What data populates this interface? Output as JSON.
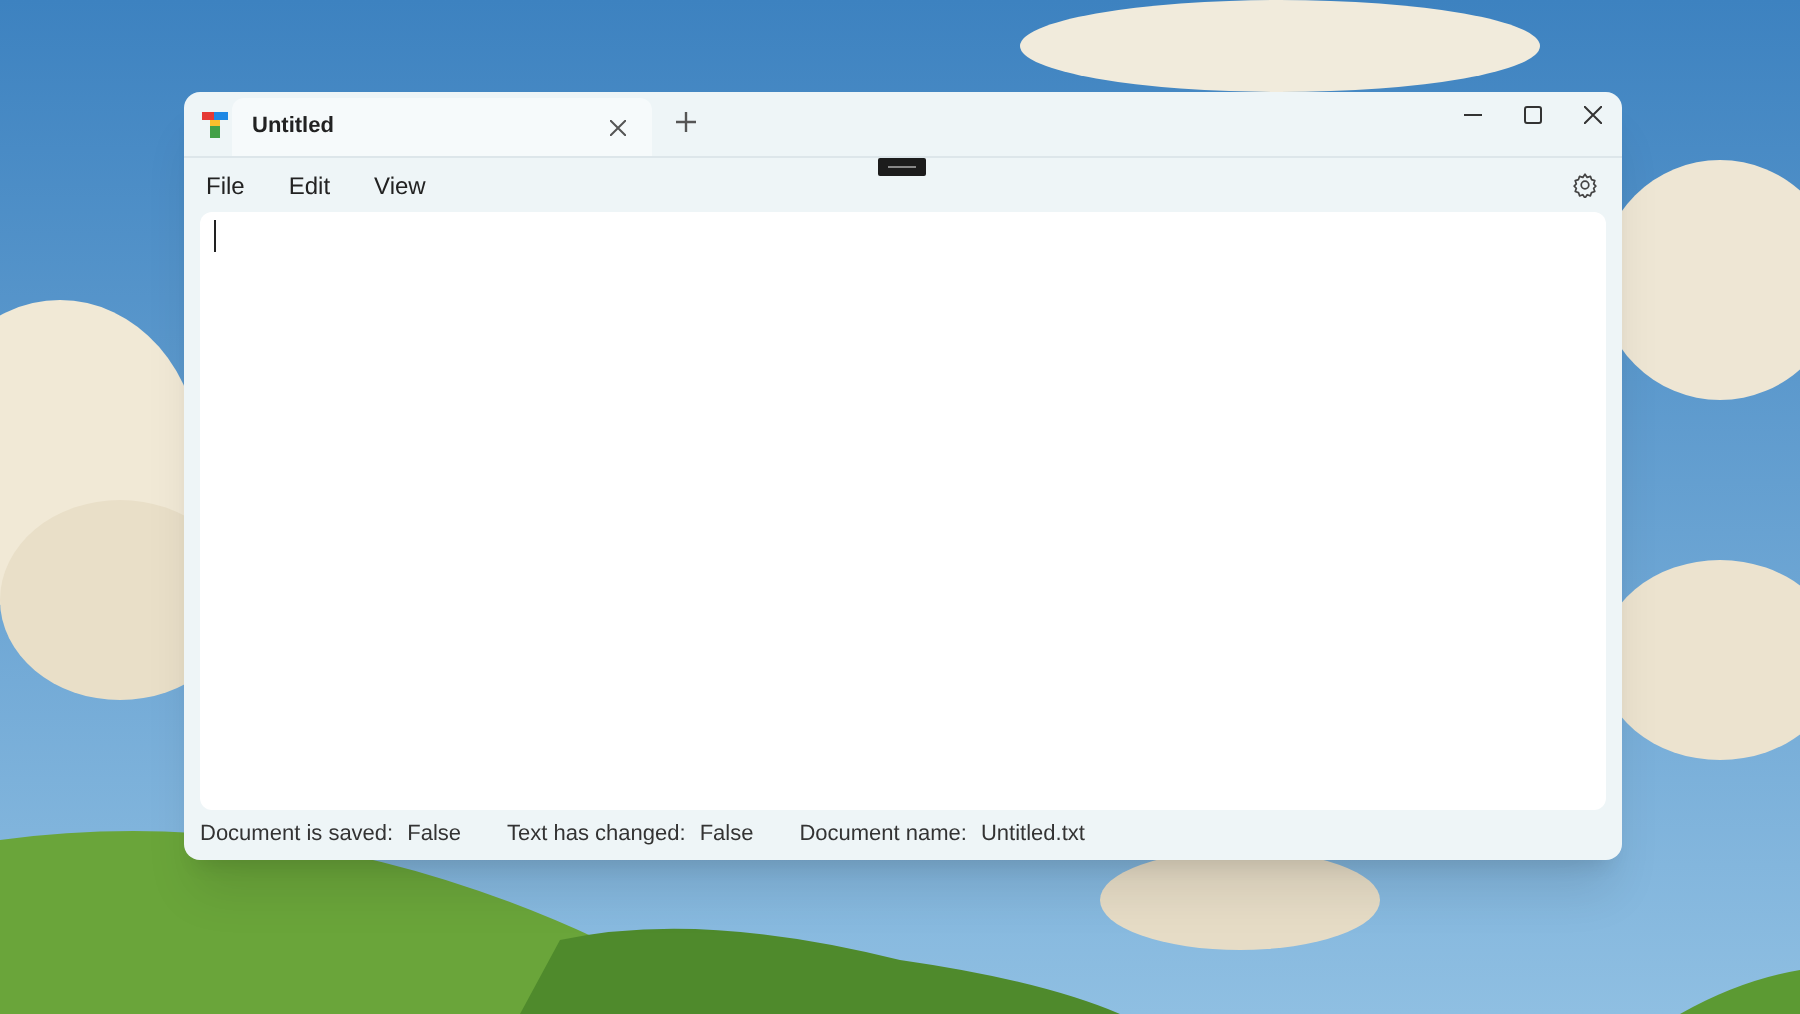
{
  "window": {
    "tabs": [
      {
        "label": "Untitled",
        "selected": true
      }
    ],
    "menu": [
      "File",
      "Edit",
      "View"
    ],
    "status_bar": [
      {
        "label": "Document is saved:",
        "value": "False"
      },
      {
        "label": "Text has changed:",
        "value": "False"
      },
      {
        "label": "Document name:",
        "value": "Untitled.txt"
      }
    ]
  }
}
